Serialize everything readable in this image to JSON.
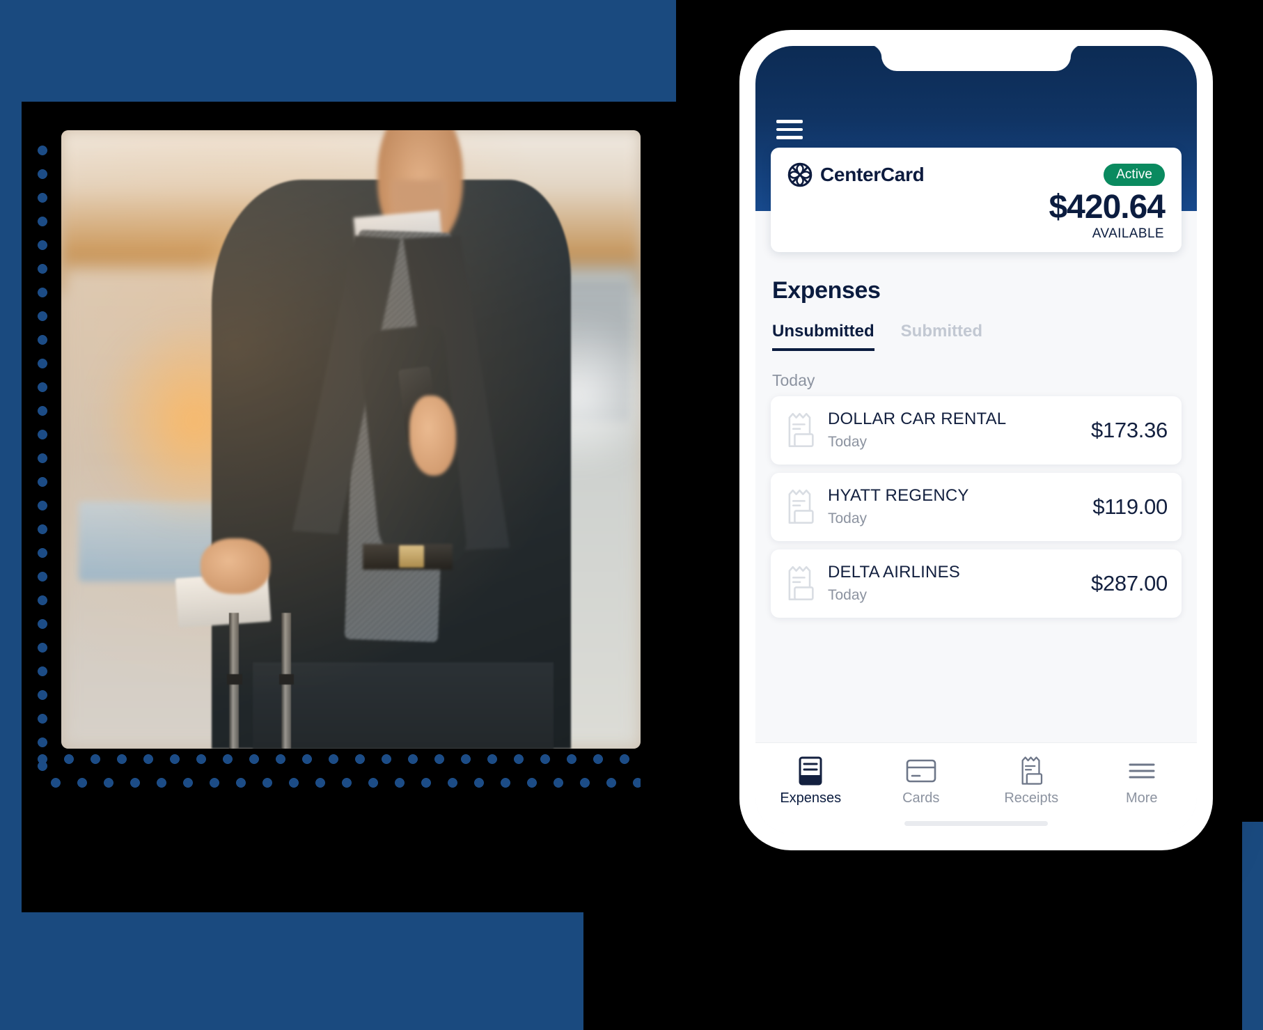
{
  "brand": {
    "accent_blue": "#1a4a7f",
    "header_gradient_from": "#0c2b54",
    "header_gradient_to": "#17498c",
    "active_green": "#0a8a5f",
    "text_navy": "#0b1c3f",
    "muted_grey": "#8c93a0",
    "dot_blue": "#1c4c86"
  },
  "phone": {
    "menu_icon": "hamburger-menu-icon",
    "card": {
      "logo_icon": "centercard-logo-icon",
      "brand_name": "CenterCard",
      "status_badge": "Active",
      "amount": "$420.64",
      "amount_caption": "AVAILABLE"
    },
    "expenses": {
      "title": "Expenses",
      "tabs": [
        {
          "label": "Unsubmitted",
          "active": true
        },
        {
          "label": "Submitted",
          "active": false
        }
      ],
      "group_label": "Today",
      "items": [
        {
          "icon": "receipt-icon",
          "merchant": "DOLLAR CAR RENTAL",
          "date": "Today",
          "amount": "$173.36"
        },
        {
          "icon": "receipt-icon",
          "merchant": "HYATT REGENCY",
          "date": "Today",
          "amount": "$119.00"
        },
        {
          "icon": "receipt-icon",
          "merchant": "DELTA AIRLINES",
          "date": "Today",
          "amount": "$287.00"
        }
      ]
    },
    "tabbar": [
      {
        "label": "Expenses",
        "icon": "expenses-document-icon",
        "active": true
      },
      {
        "label": "Cards",
        "icon": "credit-card-icon",
        "active": false
      },
      {
        "label": "Receipts",
        "icon": "receipt-icon",
        "active": false
      },
      {
        "label": "More",
        "icon": "more-menu-icon",
        "active": false
      }
    ]
  },
  "photo": {
    "alt": "businessman-in-airport-with-phone-and-luggage"
  }
}
